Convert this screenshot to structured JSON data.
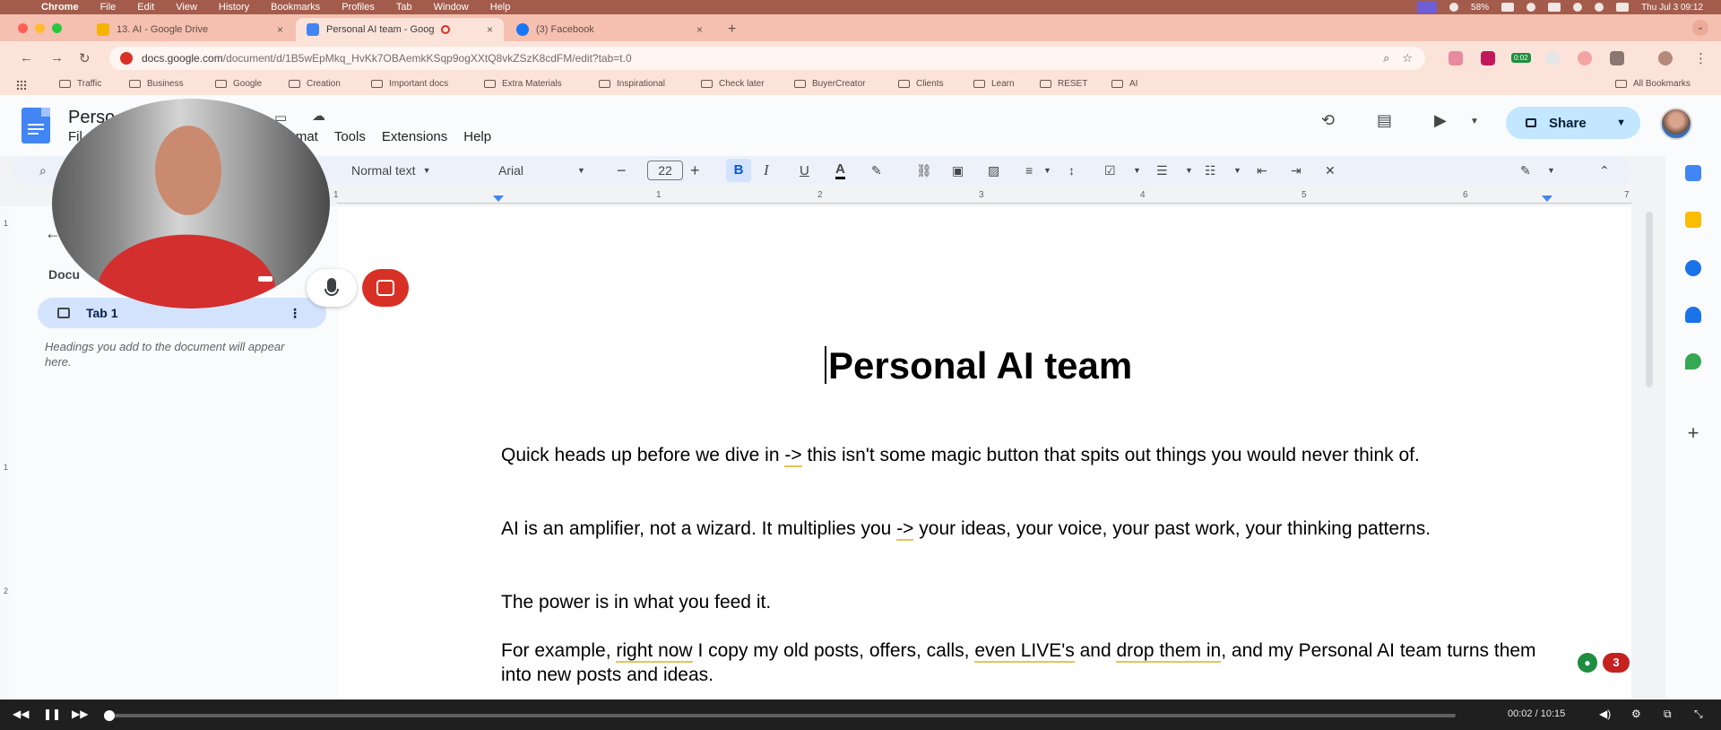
{
  "mac_menubar": {
    "app_name": "Chrome",
    "menus": [
      "File",
      "Edit",
      "View",
      "History",
      "Bookmarks",
      "Profiles",
      "Tab",
      "Window",
      "Help"
    ],
    "battery": "58%",
    "clock": "Thu Jul 3  09:12"
  },
  "browser": {
    "tabs": [
      {
        "title": "13. AI - Google Drive",
        "active": false,
        "favicon_color": "#f4b400"
      },
      {
        "title": "Personal AI team - Goog",
        "active": true,
        "favicon_color": "#4285f4"
      },
      {
        "title": "(3) Facebook",
        "active": false,
        "favicon_color": "#1877f2"
      }
    ],
    "close_glyph": "×",
    "new_tab_glyph": "+",
    "url_host": "docs.google.com",
    "url_path": "/document/d/1B5wEpMkq_HvKk7OBAemkKSqp9ogXXtQ8vkZSzK8cdFM/edit?tab=t.0",
    "extension_badge": "0:02",
    "bookmarks": [
      "Traffic",
      "Business",
      "Google",
      "Creation",
      "Important docs",
      "Extra Materials",
      "Inspirational",
      "Check later",
      "BuyerCreator",
      "Clients",
      "Learn",
      "RESET",
      "AI"
    ],
    "all_bookmarks": "All Bookmarks"
  },
  "docs": {
    "title_visible": "Perso",
    "menus_visible": [
      "Fil",
      "mat",
      "Tools",
      "Extensions",
      "Help"
    ],
    "share_label": "Share",
    "toolbar": {
      "style": "Normal text",
      "font": "Arial",
      "font_size": "22",
      "bold": "B",
      "italic": "I",
      "underline": "U",
      "text_color": "A"
    },
    "ruler_numbers": [
      "1",
      "1",
      "2",
      "3",
      "4",
      "5",
      "6",
      "7"
    ],
    "vruler_numbers": [
      "1",
      "1",
      "2"
    ],
    "sidebar": {
      "back_glyph": "←",
      "heading_visible": "Docu",
      "tab_label": "Tab 1",
      "note": "Headings you add to the document will appear here."
    },
    "document": {
      "heading": "Personal AI team",
      "p1_a": "Quick heads up before we dive in ",
      "p1_arrow": "->",
      "p1_b": "  this isn't some magic button that spits out things you would never think of.",
      "p2_a": "AI is an amplifier, not a wizard. It multiplies you ",
      "p2_arrow": "->",
      "p2_b": " your ideas, your voice, your past work, your thinking patterns.",
      "p3": "The power is in what you feed it.",
      "p4_a": "For example, ",
      "p4_u1": "right now",
      "p4_b": " I copy my old posts, offers, calls,  ",
      "p4_u2": "even LIVE's",
      "p4_c": " and ",
      "p4_u3": "drop them in",
      "p4_d": ", and my Personal AI team turns them into new posts and ideas."
    },
    "comment_badge": "3"
  },
  "player": {
    "current_time": "00:02",
    "separator": "/",
    "total_time": "10:15",
    "progress": 0.004
  },
  "colors": {
    "mac_bar": "#a35c4c",
    "tab_strip": "#f5c0b0",
    "share_bg": "#c2e7ff",
    "docs_blue": "#4285f4",
    "record_red": "#d93025"
  }
}
